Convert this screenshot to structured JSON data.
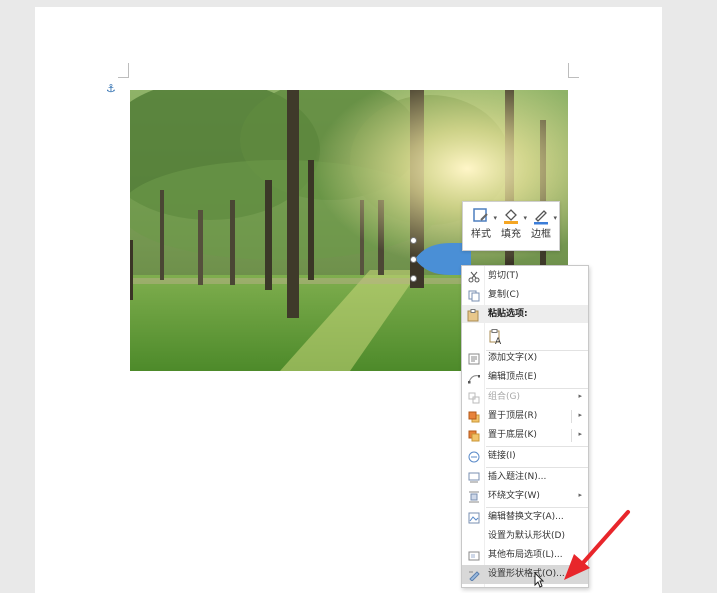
{
  "mini_toolbar": {
    "style_label": "样式",
    "fill_label": "填充",
    "border_label": "边框"
  },
  "context_menu": {
    "cut": "剪切(T)",
    "copy": "复制(C)",
    "paste_options": "粘贴选项:",
    "add_text": "添加文字(X)",
    "edit_points": "编辑顶点(E)",
    "group": "组合(G)",
    "bring_to_front": "置于顶层(R)",
    "send_to_back": "置于底层(K)",
    "link": "链接(I)",
    "insert_caption": "插入题注(N)...",
    "wrap_text": "环绕文字(W)",
    "edit_alt_text": "编辑替换文字(A)...",
    "set_default_shape": "设置为默认形状(D)",
    "more_layout": "其他布局选项(L)...",
    "format_shape": "设置形状格式(O)..."
  },
  "colors": {
    "shape_fill": "#4a8fd6",
    "fill_accent": "#f5a623",
    "border_accent": "#3b7dd8",
    "annotation_arrow": "#e8262b"
  }
}
